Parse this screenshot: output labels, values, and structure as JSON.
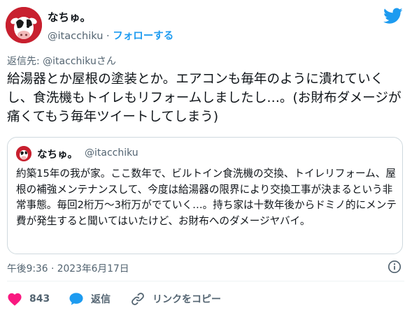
{
  "author": {
    "display_name": "なちゅ。",
    "handle": "@itacchiku",
    "separator": "·",
    "follow_label": "フォローする"
  },
  "reply_to": "返信先: @itacchikuさん",
  "tweet": {
    "text": "給湯器とか屋根の塗装とか。エアコンも毎年のように潰れていくし、食洗機もトイレもリフォームしましたし…。(お財布ダメージが痛くてもう毎年ツイートしてしまう)"
  },
  "quoted_tweet": {
    "display_name": "なちゅ。",
    "handle": "@itacchiku",
    "text": "約築15年の我が家。ここ数年で、ビルトイン食洗機の交換、トイレリフォーム、屋根の補強メンテナンスして、今度は給湯器の限界により交換工事が決まるという非常事態。毎回2桁万〜3桁万がでていく…。持ち家は十数年後からドミノ的にメンテ費が発生すると聞いてはいたけど、お財布へのダメージヤバイ。"
  },
  "timestamp": "午後9:36 · 2023年6月17日",
  "actions": {
    "like_count": "843",
    "reply_label": "返信",
    "copy_link_label": "リンクをコピー"
  },
  "icons": {
    "twitter": "twitter-bird-icon",
    "info": "info-icon",
    "like": "heart-icon",
    "reply": "speech-bubble-icon",
    "copy_link": "link-icon"
  },
  "colors": {
    "brand": "#1d9bf0",
    "like": "#f91880",
    "text": "#0f1419",
    "secondary": "#536471",
    "border": "#cfd9de"
  }
}
